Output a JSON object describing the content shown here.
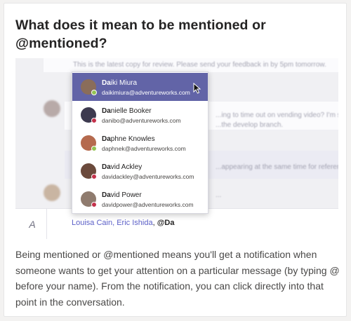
{
  "title": "What does it mean to be mentioned or @mentioned?",
  "chat_background": {
    "line1": "This is the latest copy for review. Please send your feedback in by 5pm tomorrow.",
    "line2": "...ing to time out on vending video? I'm seeing m...",
    "line3": "...the develop branch.",
    "line4": "...appearing at the same time for reference? I don't k...",
    "line5": "..."
  },
  "people": [
    {
      "match": "Da",
      "rest": "iki Miura",
      "email": "daikimiura@adventureworks.com",
      "status_color": "#92c353",
      "avatar_color": "#8a6d5a",
      "selected": true
    },
    {
      "match": "Da",
      "rest": "nielle Booker",
      "email": "danibo@adventureworks.com",
      "status_color": "#c4314b",
      "avatar_color": "#3d3a4f",
      "selected": false
    },
    {
      "match": "Da",
      "rest": "phne Knowles",
      "email": "daphnek@adventureworks.com",
      "status_color": "#92c353",
      "avatar_color": "#b56a4e",
      "selected": false
    },
    {
      "match": "Da",
      "rest": "vid Ackley",
      "email": "davidackley@adventureworks.com",
      "status_color": "#c4314b",
      "avatar_color": "#6b4a3c",
      "selected": false
    },
    {
      "match": "Da",
      "rest": "vid Power",
      "email": "davidpower@adventureworks.com",
      "status_color": "#c4314b",
      "avatar_color": "#8f7b6e",
      "selected": false
    }
  ],
  "compose": {
    "mention1": "Louisa Cain",
    "separator": ", ",
    "mention2": "Eric Ishida",
    "separator2": ", ",
    "typed": "@Da"
  },
  "description": "Being mentioned or @mentioned means you'll get a notification when someone wants to get your attention on a particular message (by typing @ before your name). From the notification, you can click directly into that point in the conversation.",
  "colors": {
    "accent": "#6264a7",
    "mention": "#5b5fc7"
  }
}
